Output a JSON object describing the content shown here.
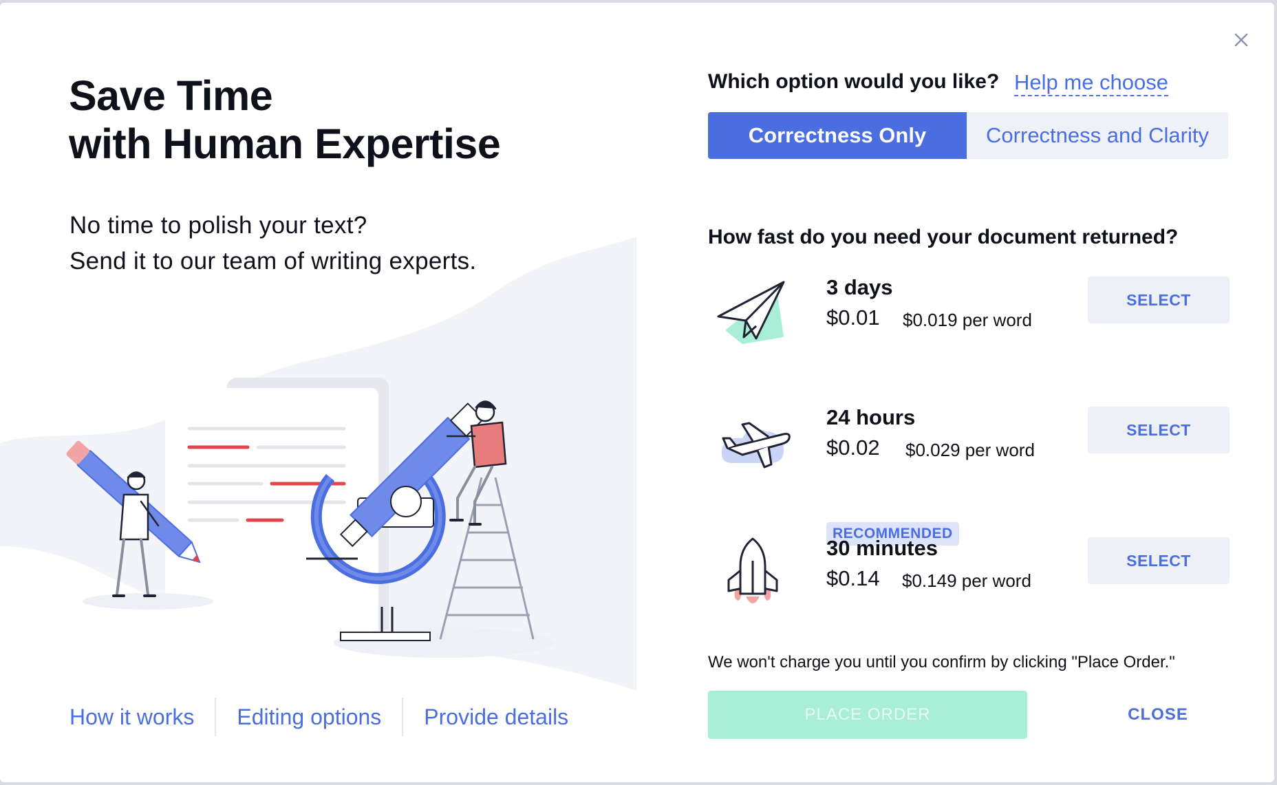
{
  "modal": {
    "title_line1": "Save Time",
    "title_line2": "with Human Expertise",
    "subtitle_line1": "No time to polish your text?",
    "subtitle_line2": "Send it to our team of writing experts.",
    "footer_links": [
      "How it works",
      "Editing options",
      "Provide details"
    ]
  },
  "options": {
    "question": "Which option would you like?",
    "help_link": "Help me choose",
    "tabs": [
      {
        "label": "Correctness Only",
        "active": true
      },
      {
        "label": "Correctness and Clarity",
        "active": false
      }
    ],
    "speed_question": "How fast do you need your document returned?",
    "speeds": [
      {
        "name": "3 days",
        "price": "$0.01",
        "per_word": "$0.019 per word",
        "button": "SELECT",
        "icon": "paper-plane-icon"
      },
      {
        "name": "24 hours",
        "price": "$0.02",
        "per_word": "$0.029 per word",
        "button": "SELECT",
        "icon": "airplane-icon"
      },
      {
        "name": "30 minutes",
        "price": "$0.14",
        "per_word": "$0.149 per word",
        "button": "SELECT",
        "icon": "rocket-icon",
        "badge": "RECOMMENDED"
      }
    ],
    "note": "We won't charge you until you confirm by clicking \"Place Order.\"",
    "place_order": "PLACE ORDER",
    "close": "CLOSE"
  },
  "colors": {
    "accent": "#4a6ee0",
    "accent_light": "#eef0f7",
    "place_order_disabled": "#a9eed7",
    "danger": "#e0464b"
  }
}
